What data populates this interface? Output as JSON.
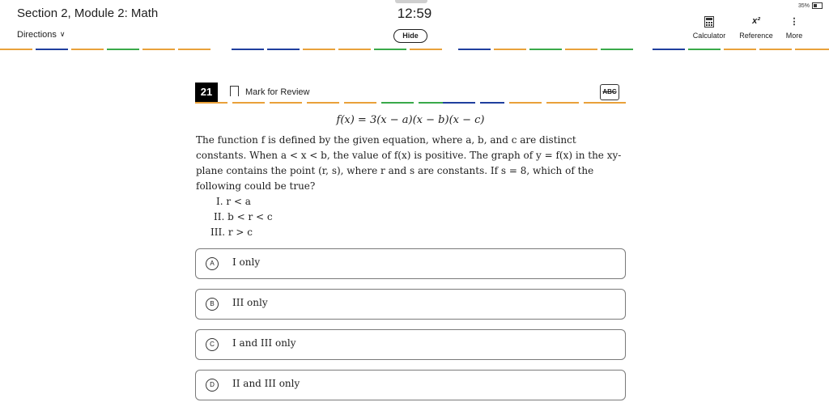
{
  "header": {
    "section_title": "Section 2, Module 2: Math",
    "directions_label": "Directions",
    "timer": "12:59",
    "hide_label": "Hide",
    "battery": "35%",
    "tools": [
      {
        "label": "Calculator",
        "icon": "calculator-icon"
      },
      {
        "label": "Reference",
        "icon": "reference-icon",
        "glyph": "x²"
      },
      {
        "label": "More",
        "icon": "more-vert-icon",
        "glyph": "⋮"
      }
    ]
  },
  "question": {
    "number": "21",
    "mark_label": "Mark for Review",
    "strike_label": "ABC",
    "equation": "f(x) = 3(x − a)(x − b)(x − c)",
    "stem": "The function f is defined by the given equation, where a, b, and c are distinct constants. When a < x < b, the value of f(x) is positive. The graph of y = f(x) in the xy-plane contains the point (r, s), where r and s are constants. If s = 8, which of the following could be true?",
    "statements": [
      "I. r < a",
      "II. b < r < c",
      "III. r > c"
    ]
  },
  "choices": [
    {
      "letter": "A",
      "text": "I only"
    },
    {
      "letter": "B",
      "text": "III only"
    },
    {
      "letter": "C",
      "text": "I and III only"
    },
    {
      "letter": "D",
      "text": "II and III only"
    }
  ],
  "colors": {
    "dash_blue": "#1f3f9e",
    "dash_green": "#39a94a",
    "dash_orange": "#e9a13a"
  }
}
